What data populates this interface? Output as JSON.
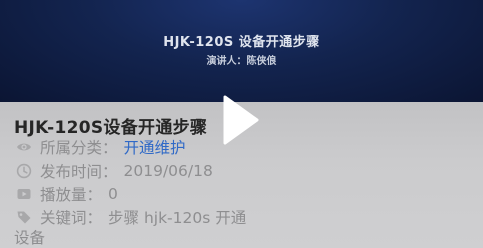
{
  "banner": {
    "title": "HJK-120S 设备开通步骤",
    "presenter_label": "演讲人：",
    "presenter_name": "陈侠俍"
  },
  "content": {
    "title": "HJK-120S设备开通步骤",
    "category_label": "所属分类：",
    "category_value": "开通维护",
    "date_label": "发布时间：",
    "date_value": "2019/06/18",
    "plays_label": "播放量：",
    "plays_value": "0",
    "keywords_label": "关键词：",
    "keywords_value": "步骤 hjk-120s 开通",
    "keywords_value_cont": "设备"
  },
  "icons": {
    "category": "eye-icon",
    "date": "clock-icon",
    "plays": "play-count-icon",
    "keywords": "tag-icon",
    "overlay": "play-icon"
  },
  "colors": {
    "banner_bg": "#13244f",
    "panel_bg": "#cbcbcd",
    "title_text": "#262626",
    "meta_text": "#8e8e90",
    "link": "#2f69c7"
  }
}
